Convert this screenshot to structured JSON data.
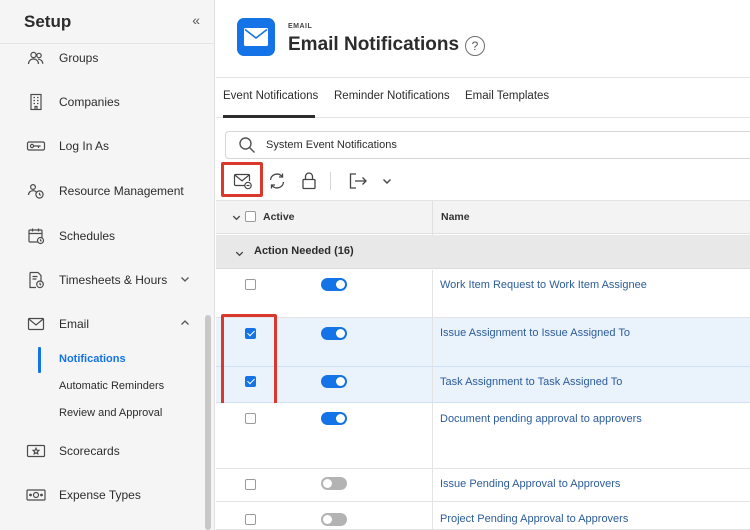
{
  "sidebar": {
    "title": "Setup",
    "collapse_icon": "«",
    "items": [
      {
        "label": "Groups",
        "icon": "groups-icon"
      },
      {
        "label": "Companies",
        "icon": "companies-icon"
      },
      {
        "label": "Log In As",
        "icon": "key-icon"
      },
      {
        "label": "Resource Management",
        "icon": "resource-management-icon"
      },
      {
        "label": "Schedules",
        "icon": "calendar-icon"
      },
      {
        "label": "Timesheets & Hours",
        "icon": "timesheet-icon"
      },
      {
        "label": "Email",
        "icon": "envelope-icon"
      },
      {
        "label": "Scorecards",
        "icon": "scorecard-icon"
      },
      {
        "label": "Expense Types",
        "icon": "money-icon"
      }
    ],
    "email_subitems": [
      {
        "label": "Notifications",
        "active": true
      },
      {
        "label": "Automatic Reminders",
        "active": false
      },
      {
        "label": "Review and Approval",
        "active": false
      }
    ]
  },
  "header": {
    "kicker": "EMAIL",
    "title": "Email Notifications",
    "help_label": "?"
  },
  "tabs": [
    {
      "label": "Event Notifications",
      "active": true
    },
    {
      "label": "Reminder Notifications",
      "active": false
    },
    {
      "label": "Email Templates",
      "active": false
    }
  ],
  "search": {
    "value": "System Event Notifications"
  },
  "table": {
    "columns": {
      "active": "Active",
      "name": "Name"
    },
    "group": {
      "label": "Action Needed (16)"
    },
    "rows": [
      {
        "checked": false,
        "active": true,
        "name": "Work Item Request to Work Item Assignee"
      },
      {
        "checked": true,
        "active": true,
        "name": "Issue Assignment to Issue Assigned To"
      },
      {
        "checked": true,
        "active": true,
        "name": "Task Assignment to Task Assigned To"
      },
      {
        "checked": false,
        "active": true,
        "name": "Document pending approval to approvers"
      },
      {
        "checked": false,
        "active": false,
        "name": "Issue Pending Approval to Approvers"
      },
      {
        "checked": false,
        "active": false,
        "name": "Project Pending Approval to Approvers"
      }
    ]
  },
  "colors": {
    "accent": "#1473e6",
    "highlight": "#d9382c",
    "link": "#2c5c9a"
  }
}
